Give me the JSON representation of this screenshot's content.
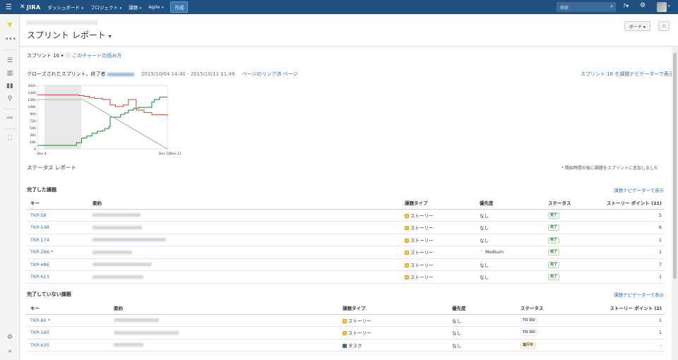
{
  "nav": {
    "logo": "JIRA",
    "items": [
      {
        "label": "ダッシュボード"
      },
      {
        "label": "プロジェクト"
      },
      {
        "label": "課題"
      },
      {
        "label": "Agile"
      }
    ],
    "create": "作成",
    "search_placeholder": "検索"
  },
  "header": {
    "title": "スプリント レポート",
    "board_button": "ボード",
    "star": "☆"
  },
  "sprint_select": "スプリント 16",
  "chart_help": "このチャートの読み方",
  "sprint_info": {
    "closed_prefix": "クローズされたスプリント。終了者",
    "dates": "2015/10/04 14:40 - 2015/10/11 11:49",
    "linked_pages": "ページのリンク済 ページ",
    "view_in_navigator": "スプリント 16 を課題ナビゲーターで表示"
  },
  "chart_data": {
    "type": "line",
    "y_ticks": [
      "162h",
      "144h",
      "126h",
      "108h",
      "90h",
      "72h",
      "54h",
      "36h",
      "18h",
      "0"
    ],
    "x_ticks": [
      "Dec 4",
      "Dec 10",
      "Dec 11"
    ],
    "ylim": [
      0,
      162
    ],
    "series": [
      {
        "color": "#d04437",
        "points": [
          [
            0,
            138
          ],
          [
            0.3,
            138
          ],
          [
            0.32,
            136
          ],
          [
            0.36,
            134
          ],
          [
            0.4,
            131
          ],
          [
            0.44,
            129
          ],
          [
            0.48,
            129
          ],
          [
            0.5,
            126
          ],
          [
            0.55,
            126
          ],
          [
            0.56,
            112
          ],
          [
            0.6,
            108
          ],
          [
            0.65,
            108
          ],
          [
            0.66,
            112
          ],
          [
            0.7,
            126
          ],
          [
            0.74,
            126
          ],
          [
            0.76,
            99
          ],
          [
            0.82,
            93
          ],
          [
            0.86,
            93
          ],
          [
            0.88,
            87
          ],
          [
            1,
            84
          ]
        ]
      },
      {
        "color": "#14892c",
        "points": [
          [
            0,
            9
          ],
          [
            0.28,
            9
          ],
          [
            0.3,
            16
          ],
          [
            0.34,
            28
          ],
          [
            0.38,
            33
          ],
          [
            0.42,
            40
          ],
          [
            0.46,
            45
          ],
          [
            0.5,
            47
          ],
          [
            0.52,
            52
          ],
          [
            0.55,
            57
          ],
          [
            0.56,
            81
          ],
          [
            0.6,
            81
          ],
          [
            0.64,
            88
          ],
          [
            0.67,
            92
          ],
          [
            0.7,
            99
          ],
          [
            0.74,
            104
          ],
          [
            0.78,
            106
          ],
          [
            0.86,
            106
          ],
          [
            0.88,
            120
          ],
          [
            0.9,
            126
          ],
          [
            0.94,
            132
          ],
          [
            1,
            132
          ]
        ]
      },
      {
        "color": "#999999",
        "points": [
          [
            0,
            126
          ],
          [
            0.35,
            126
          ],
          [
            1,
            0
          ]
        ]
      }
    ]
  },
  "status_report_title": "ステータス レポート",
  "added_note": "* 開始時間の後に課題をスプリントに追加しました",
  "completed": {
    "title": "完了した課題",
    "link": "課題ナビゲーターで表示",
    "headers": [
      "キー",
      "要約",
      "課題タイプ",
      "優先度",
      "ステータス",
      "ストーリー ポイント (21)"
    ],
    "rows": [
      {
        "key": "TKP-58",
        "type": "ストーリー",
        "priority": "なし",
        "status": "完了",
        "points": "5"
      },
      {
        "key": "TKP-148",
        "type": "ストーリー",
        "priority": "なし",
        "status": "完了",
        "points": "6"
      },
      {
        "key": "TKP-174",
        "type": "ストーリー",
        "priority": "なし",
        "status": "完了",
        "points": "1"
      },
      {
        "key": "TKP-296 *",
        "type": "ストーリー",
        "priority": "Medium",
        "status": "完了",
        "points": "1"
      },
      {
        "key": "TKP-486",
        "type": "ストーリー",
        "priority": "なし",
        "status": "完了",
        "points": "7"
      },
      {
        "key": "TKP-613",
        "type": "ストーリー",
        "priority": "なし",
        "status": "完了",
        "points": "1"
      }
    ]
  },
  "incomplete": {
    "title": "完了していない課題",
    "link": "課題ナビゲーターで表示",
    "headers": [
      "キー",
      "要約",
      "課題タイプ",
      "優先度",
      "ステータス",
      "ストーリー ポイント (2)"
    ],
    "rows": [
      {
        "key": "TKP-60 *",
        "type": "ストーリー",
        "priority": "なし",
        "status": "TO DO",
        "points": "1"
      },
      {
        "key": "TKP-160",
        "type": "ストーリー",
        "priority": "なし",
        "status": "TO DO",
        "points": "1"
      },
      {
        "key": "TKP-635",
        "type": "タスク",
        "priority": "なし",
        "status": "進行中",
        "points": "-"
      }
    ]
  }
}
